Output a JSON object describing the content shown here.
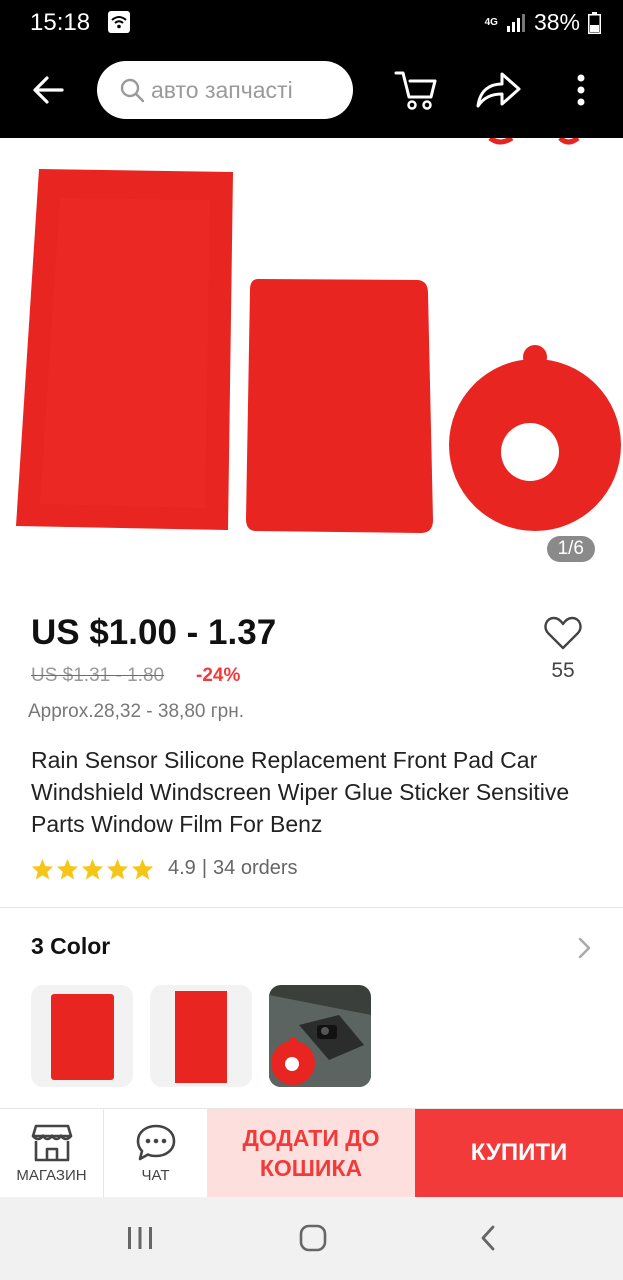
{
  "status_bar": {
    "time": "15:18",
    "network": "4G",
    "battery": "38%"
  },
  "header": {
    "search_placeholder": "авто запчасті"
  },
  "gallery": {
    "counter": "1/6"
  },
  "product": {
    "price": "US $1.00 - 1.37",
    "old_price": "US $1.31 - 1.80",
    "discount": "-24%",
    "approx_price": "Approx.28,32 - 38,80 грн.",
    "wishlist_count": "55",
    "title": "Rain Sensor Silicone Replacement Front Pad Car Windshield Windscreen Wiper Glue Sticker Sensitive Parts Window Film For Benz",
    "rating": "4.9",
    "orders": "34 orders",
    "stars": 5
  },
  "variants": {
    "heading": "3 Color",
    "options": [
      "red-rectangle-small",
      "red-rectangle-tall",
      "red-round-installed"
    ]
  },
  "actions": {
    "store_label": "МАГАЗИН",
    "chat_label": "ЧАТ",
    "add_to_cart_label": "ДОДАТИ ДО КОШИКА",
    "buy_label": "КУПИТИ"
  },
  "colors": {
    "accent": "#f23a3a",
    "cart_bg": "#fde0dd",
    "star": "#f5c518"
  }
}
